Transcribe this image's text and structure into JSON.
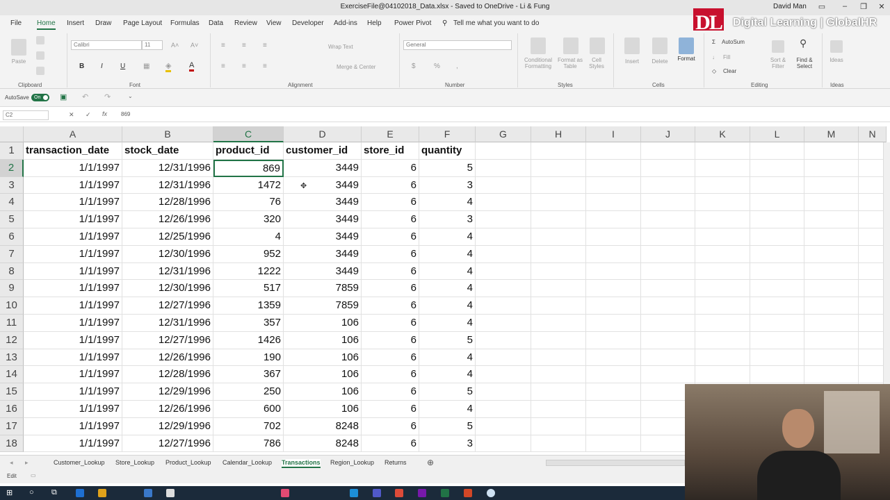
{
  "window": {
    "title": "ExerciseFile@04102018_Data.xlsx  -  Saved to OneDrive - Li & Fung",
    "user": "David Man"
  },
  "overlay": {
    "logo_text": "DL",
    "brand_text": "Digital Learning | GlobalHR"
  },
  "ribbon_tabs": [
    "File",
    "Home",
    "Insert",
    "Draw",
    "Page Layout",
    "Formulas",
    "Data",
    "Review",
    "View",
    "Developer",
    "Add-ins",
    "Help",
    "Power Pivot"
  ],
  "tell_me": "Tell me what you want to do",
  "ribbon": {
    "font_name": "Calibri",
    "font_size": "11",
    "number_format": "General",
    "labels": {
      "paste": "Paste",
      "wrap_text": "Wrap Text",
      "merge_center": "Merge & Center",
      "cond_format": "Conditional Formatting",
      "format_table": "Format as Table",
      "cell_styles": "Cell Styles",
      "insert": "Insert",
      "delete": "Delete",
      "format": "Format",
      "autosum": "AutoSum",
      "fill": "Fill",
      "clear": "Clear",
      "sort_filter": "Sort & Filter",
      "find_select": "Find & Select",
      "ideas": "Ideas"
    },
    "groups": {
      "clipboard": "Clipboard",
      "font": "Font",
      "alignment": "Alignment",
      "number": "Number",
      "styles": "Styles",
      "cells": "Cells",
      "editing": "Editing",
      "ideas": "Ideas"
    }
  },
  "qat": {
    "autosave_label": "AutoSave",
    "autosave_state": "On"
  },
  "formula_bar": {
    "name_box": "C2",
    "formula": "869"
  },
  "grid": {
    "columns": [
      "A",
      "B",
      "C",
      "D",
      "E",
      "F",
      "G",
      "H",
      "I",
      "J",
      "K",
      "L",
      "M",
      "N"
    ],
    "selected_column": "C",
    "selected_row": "2",
    "headers": [
      "transaction_date",
      "stock_date",
      "product_id",
      "customer_id",
      "store_id",
      "quantity"
    ],
    "rows": [
      {
        "n": "2",
        "cells": [
          "1/1/1997",
          "12/31/1996",
          "869",
          "3449",
          "6",
          "5"
        ]
      },
      {
        "n": "3",
        "cells": [
          "1/1/1997",
          "12/31/1996",
          "1472",
          "3449",
          "6",
          "3"
        ]
      },
      {
        "n": "4",
        "cells": [
          "1/1/1997",
          "12/28/1996",
          "76",
          "3449",
          "6",
          "4"
        ]
      },
      {
        "n": "5",
        "cells": [
          "1/1/1997",
          "12/26/1996",
          "320",
          "3449",
          "6",
          "3"
        ]
      },
      {
        "n": "6",
        "cells": [
          "1/1/1997",
          "12/25/1996",
          "4",
          "3449",
          "6",
          "4"
        ]
      },
      {
        "n": "7",
        "cells": [
          "1/1/1997",
          "12/30/1996",
          "952",
          "3449",
          "6",
          "4"
        ]
      },
      {
        "n": "8",
        "cells": [
          "1/1/1997",
          "12/31/1996",
          "1222",
          "3449",
          "6",
          "4"
        ]
      },
      {
        "n": "9",
        "cells": [
          "1/1/1997",
          "12/30/1996",
          "517",
          "7859",
          "6",
          "4"
        ]
      },
      {
        "n": "10",
        "cells": [
          "1/1/1997",
          "12/27/1996",
          "1359",
          "7859",
          "6",
          "4"
        ]
      },
      {
        "n": "11",
        "cells": [
          "1/1/1997",
          "12/31/1996",
          "357",
          "106",
          "6",
          "4"
        ]
      },
      {
        "n": "12",
        "cells": [
          "1/1/1997",
          "12/27/1996",
          "1426",
          "106",
          "6",
          "5"
        ]
      },
      {
        "n": "13",
        "cells": [
          "1/1/1997",
          "12/26/1996",
          "190",
          "106",
          "6",
          "4"
        ]
      },
      {
        "n": "14",
        "cells": [
          "1/1/1997",
          "12/28/1996",
          "367",
          "106",
          "6",
          "4"
        ]
      },
      {
        "n": "15",
        "cells": [
          "1/1/1997",
          "12/29/1996",
          "250",
          "106",
          "6",
          "5"
        ]
      },
      {
        "n": "16",
        "cells": [
          "1/1/1997",
          "12/26/1996",
          "600",
          "106",
          "6",
          "4"
        ]
      },
      {
        "n": "17",
        "cells": [
          "1/1/1997",
          "12/29/1996",
          "702",
          "8248",
          "6",
          "5"
        ]
      },
      {
        "n": "18",
        "cells": [
          "1/1/1997",
          "12/27/1996",
          "786",
          "8248",
          "6",
          "3"
        ]
      }
    ]
  },
  "sheet_tabs": [
    "Customer_Lookup",
    "Store_Lookup",
    "Product_Lookup",
    "Calendar_Lookup",
    "Transactions",
    "Region_Lookup",
    "Returns"
  ],
  "active_sheet": "Transactions",
  "status": {
    "mode": "Edit"
  },
  "colors": {
    "accent": "#217346",
    "brand_red": "#c8102e"
  },
  "icons": [
    "undo-icon",
    "redo-icon",
    "save-icon",
    "bold-icon",
    "italic-icon",
    "underline-icon",
    "add-sheet-icon",
    "cursor-icon"
  ]
}
